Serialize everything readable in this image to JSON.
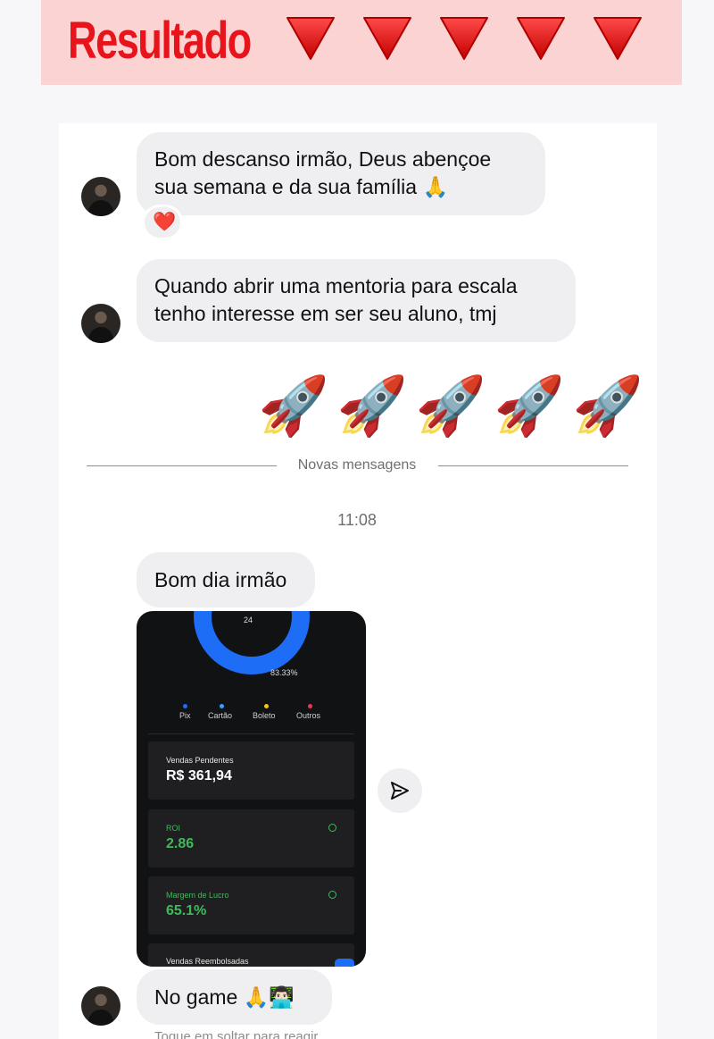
{
  "banner": {
    "title": "Resultado",
    "arrow_count": 5,
    "background": "#fcd3d3",
    "title_color": "#e8141b"
  },
  "messages": [
    {
      "lines": [
        "Bom descanso irmão, Deus abençoe",
        "sua semana e da sua família 🙏"
      ],
      "reaction": "❤️"
    },
    {
      "lines": [
        "Quando abrir uma mentoria para escala",
        "tenho interesse em ser seu aluno, tmj"
      ]
    }
  ],
  "sent_emojis": [
    "🚀",
    "🚀",
    "🚀",
    "🚀",
    "🚀"
  ],
  "divider": {
    "label": "Novas mensagens"
  },
  "timestamp": "11:08",
  "greeting": "Bom dia irmão",
  "screenshot": {
    "donut_total_label": "24",
    "donut_percent": "83.33%",
    "donut_fill": 0.8333,
    "legend": [
      {
        "label": "Pix",
        "color": "#1e6df6"
      },
      {
        "label": "Cartão",
        "color": "#3aa0ff"
      },
      {
        "label": "Boleto",
        "color": "#f5c518"
      },
      {
        "label": "Outros",
        "color": "#e8335a"
      }
    ],
    "pending": {
      "label": "Vendas Pendentes",
      "value": "R$ 361,94"
    },
    "roi": {
      "label": "ROI",
      "value": "2.86"
    },
    "margin": {
      "label": "Margem de Lucro",
      "value": "65.1%"
    },
    "refunds": {
      "label": "Vendas Reembolsadas"
    }
  },
  "last_message": {
    "text": "No game 🙏👨🏻‍💻"
  },
  "hint": "Toque em soltar para reagir",
  "icons": {
    "send": "send-icon",
    "info": "info-icon"
  }
}
